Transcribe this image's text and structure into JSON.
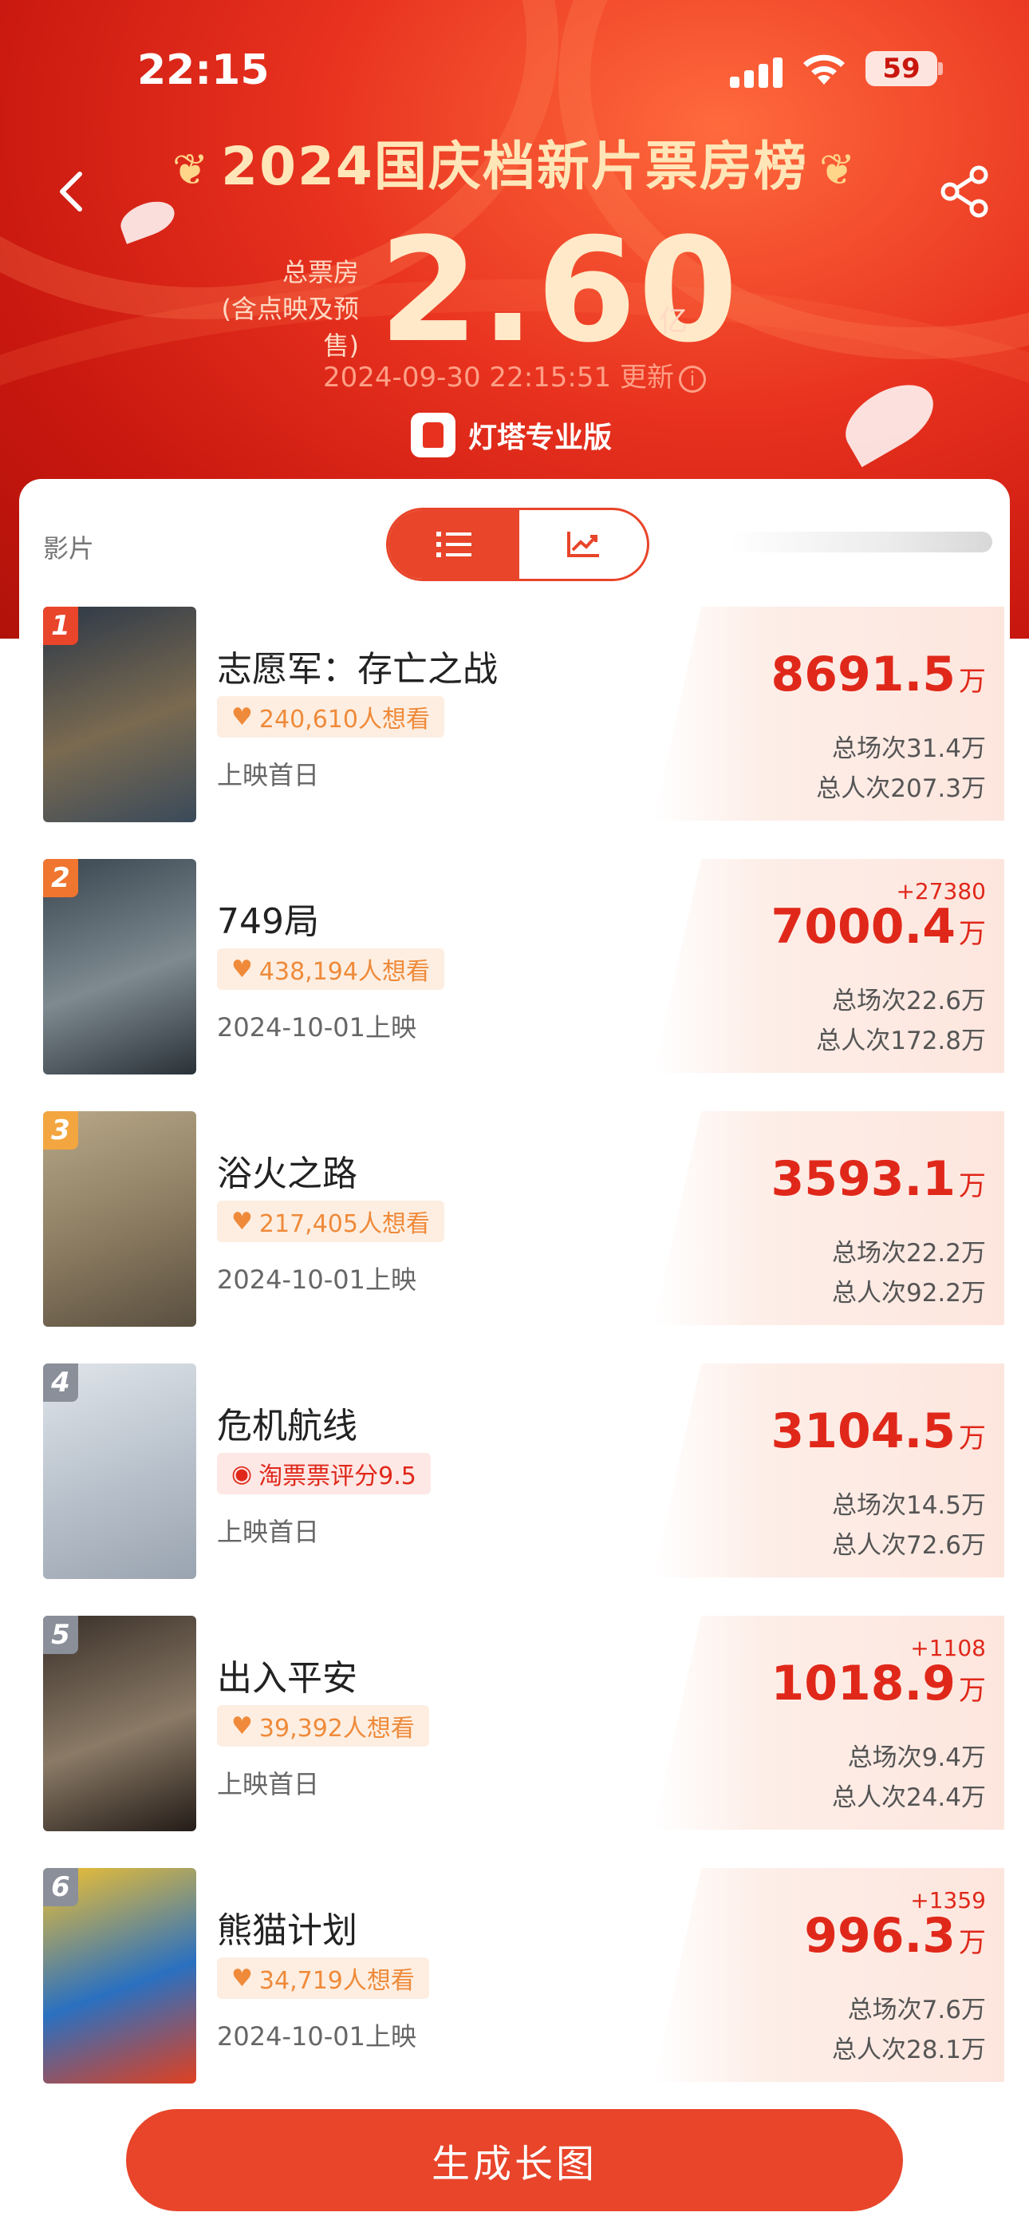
{
  "status_bar": {
    "time": "22:15",
    "battery": "59"
  },
  "header": {
    "title": "2024国庆档新片票房榜",
    "total_label_1": "总票房",
    "total_label_2": "(含点映及预售)",
    "total_value": "2.60",
    "total_unit": "亿",
    "updated": "2024-09-30 22:15:51 更新",
    "brand": "灯塔专业版"
  },
  "list": {
    "column_label": "影片",
    "view_mode": "list",
    "movies": [
      {
        "rank": "1",
        "name": "志愿军：存亡之战",
        "tag": "240,610人想看",
        "tag_type": "want",
        "release": "上映首日",
        "delta": "",
        "gross": "8691.5",
        "unit": "万",
        "shows": "总场次31.4万",
        "admissions": "总人次207.3万",
        "rank_color": "#e8452a"
      },
      {
        "rank": "2",
        "name": "749局",
        "tag": "438,194人想看",
        "tag_type": "want",
        "release": "2024-10-01上映",
        "delta": "+27380",
        "gross": "7000.4",
        "unit": "万",
        "shows": "总场次22.6万",
        "admissions": "总人次172.8万",
        "rank_color": "#f0752f"
      },
      {
        "rank": "3",
        "name": "浴火之路",
        "tag": "217,405人想看",
        "tag_type": "want",
        "release": "2024-10-01上映",
        "delta": "",
        "gross": "3593.1",
        "unit": "万",
        "shows": "总场次22.2万",
        "admissions": "总人次92.2万",
        "rank_color": "#f3a640"
      },
      {
        "rank": "4",
        "name": "危机航线",
        "tag": "淘票票评分9.5",
        "tag_type": "rating",
        "release": "上映首日",
        "delta": "",
        "gross": "3104.5",
        "unit": "万",
        "shows": "总场次14.5万",
        "admissions": "总人次72.6万",
        "rank_color": "#8a8f99"
      },
      {
        "rank": "5",
        "name": "出入平安",
        "tag": "39,392人想看",
        "tag_type": "want",
        "release": "上映首日",
        "delta": "+1108",
        "gross": "1018.9",
        "unit": "万",
        "shows": "总场次9.4万",
        "admissions": "总人次24.4万",
        "rank_color": "#8a8f99"
      },
      {
        "rank": "6",
        "name": "熊猫计划",
        "tag": "34,719人想看",
        "tag_type": "want",
        "release": "2024-10-01上映",
        "delta": "+1359",
        "gross": "996.3",
        "unit": "万",
        "shows": "总场次7.6万",
        "admissions": "总人次28.1万",
        "rank_color": "#8a8f99"
      }
    ]
  },
  "footer": {
    "cta": "生成长图"
  },
  "colors": {
    "accent": "#e8452a",
    "gross": "#e0281a",
    "hero_bg": "#d8241a"
  }
}
